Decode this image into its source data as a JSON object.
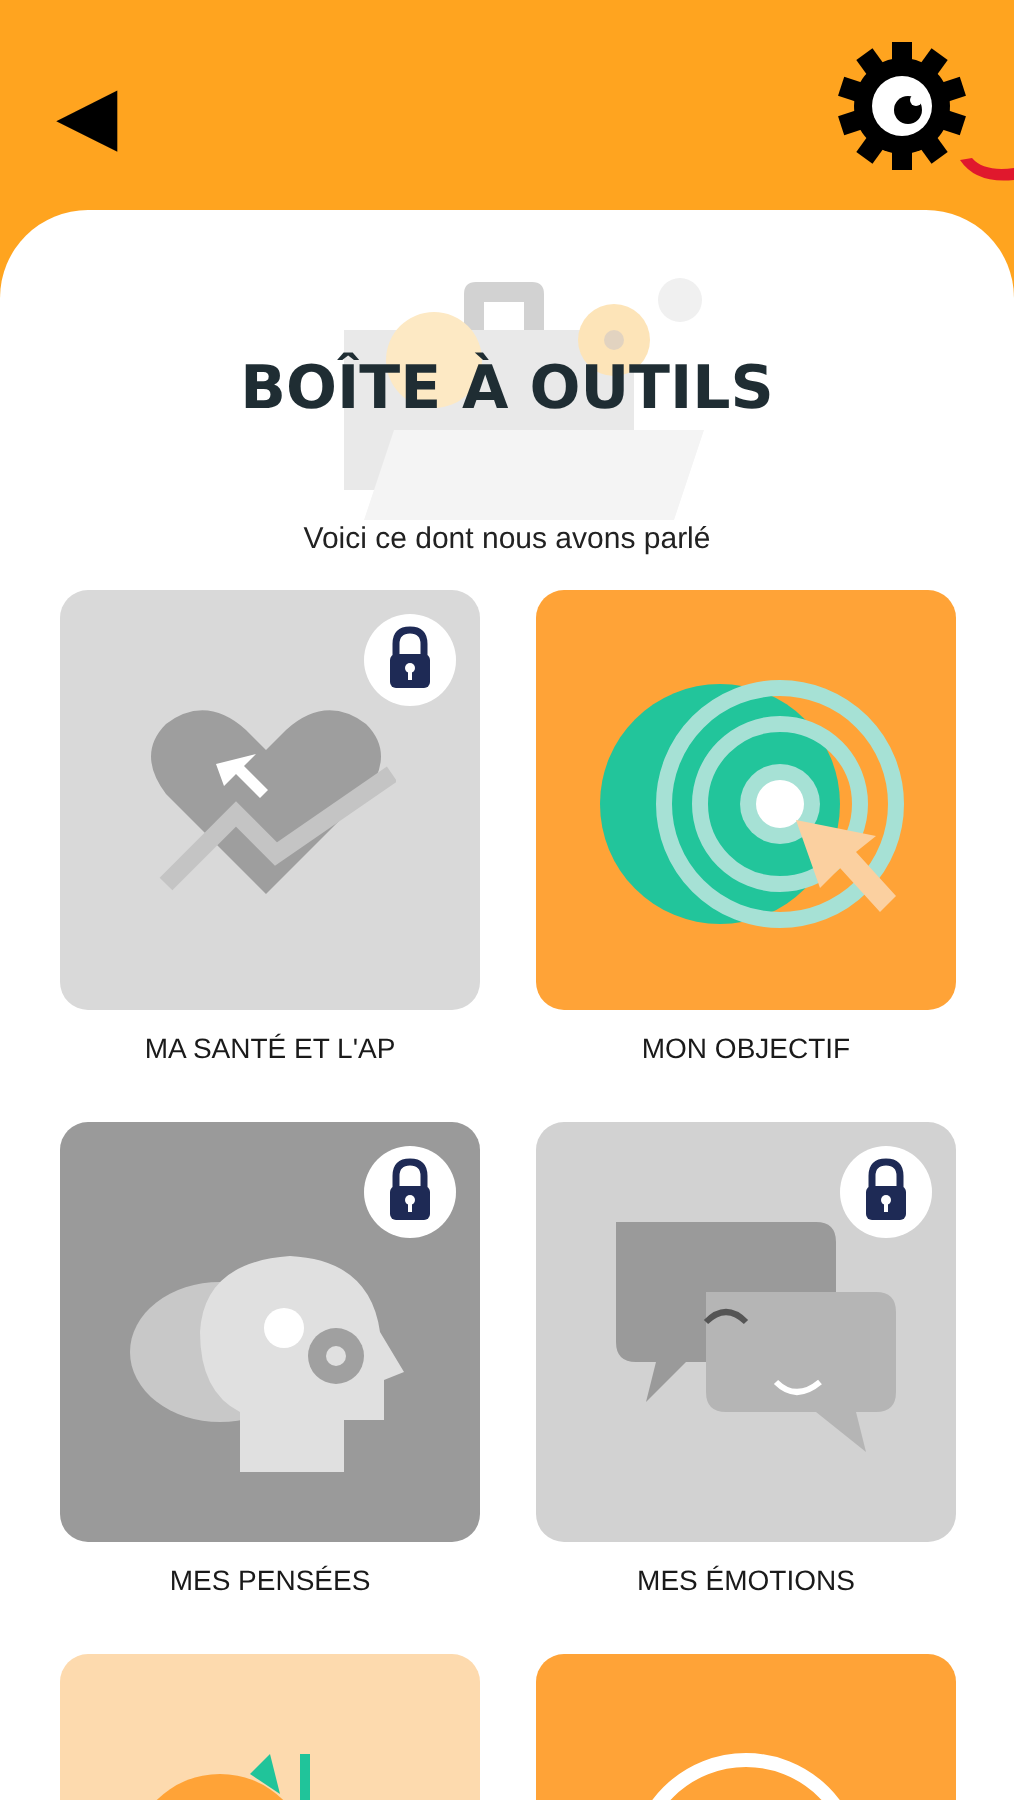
{
  "header": {
    "back": "◀"
  },
  "title": "BOÎTE À OUTILS",
  "subtitle": "Voici ce dont nous avons parlé",
  "tiles": [
    {
      "kind": "heart",
      "label": "MA SANTÉ ET L'AP",
      "locked": true,
      "color": "#d9d9d9"
    },
    {
      "kind": "target",
      "label": "MON OBJECTIF",
      "locked": false,
      "color": "#ffa337"
    },
    {
      "kind": "head",
      "label": "MES PENSÉES",
      "locked": true,
      "color": "#9a9a9a"
    },
    {
      "kind": "chat",
      "label": "MES ÉMOTIONS",
      "locked": true,
      "color": "#d2d2d2"
    },
    {
      "kind": "plant",
      "locked": false,
      "color": "#fddaae"
    },
    {
      "kind": "ring",
      "locked": false,
      "color": "#ffa337"
    }
  ]
}
